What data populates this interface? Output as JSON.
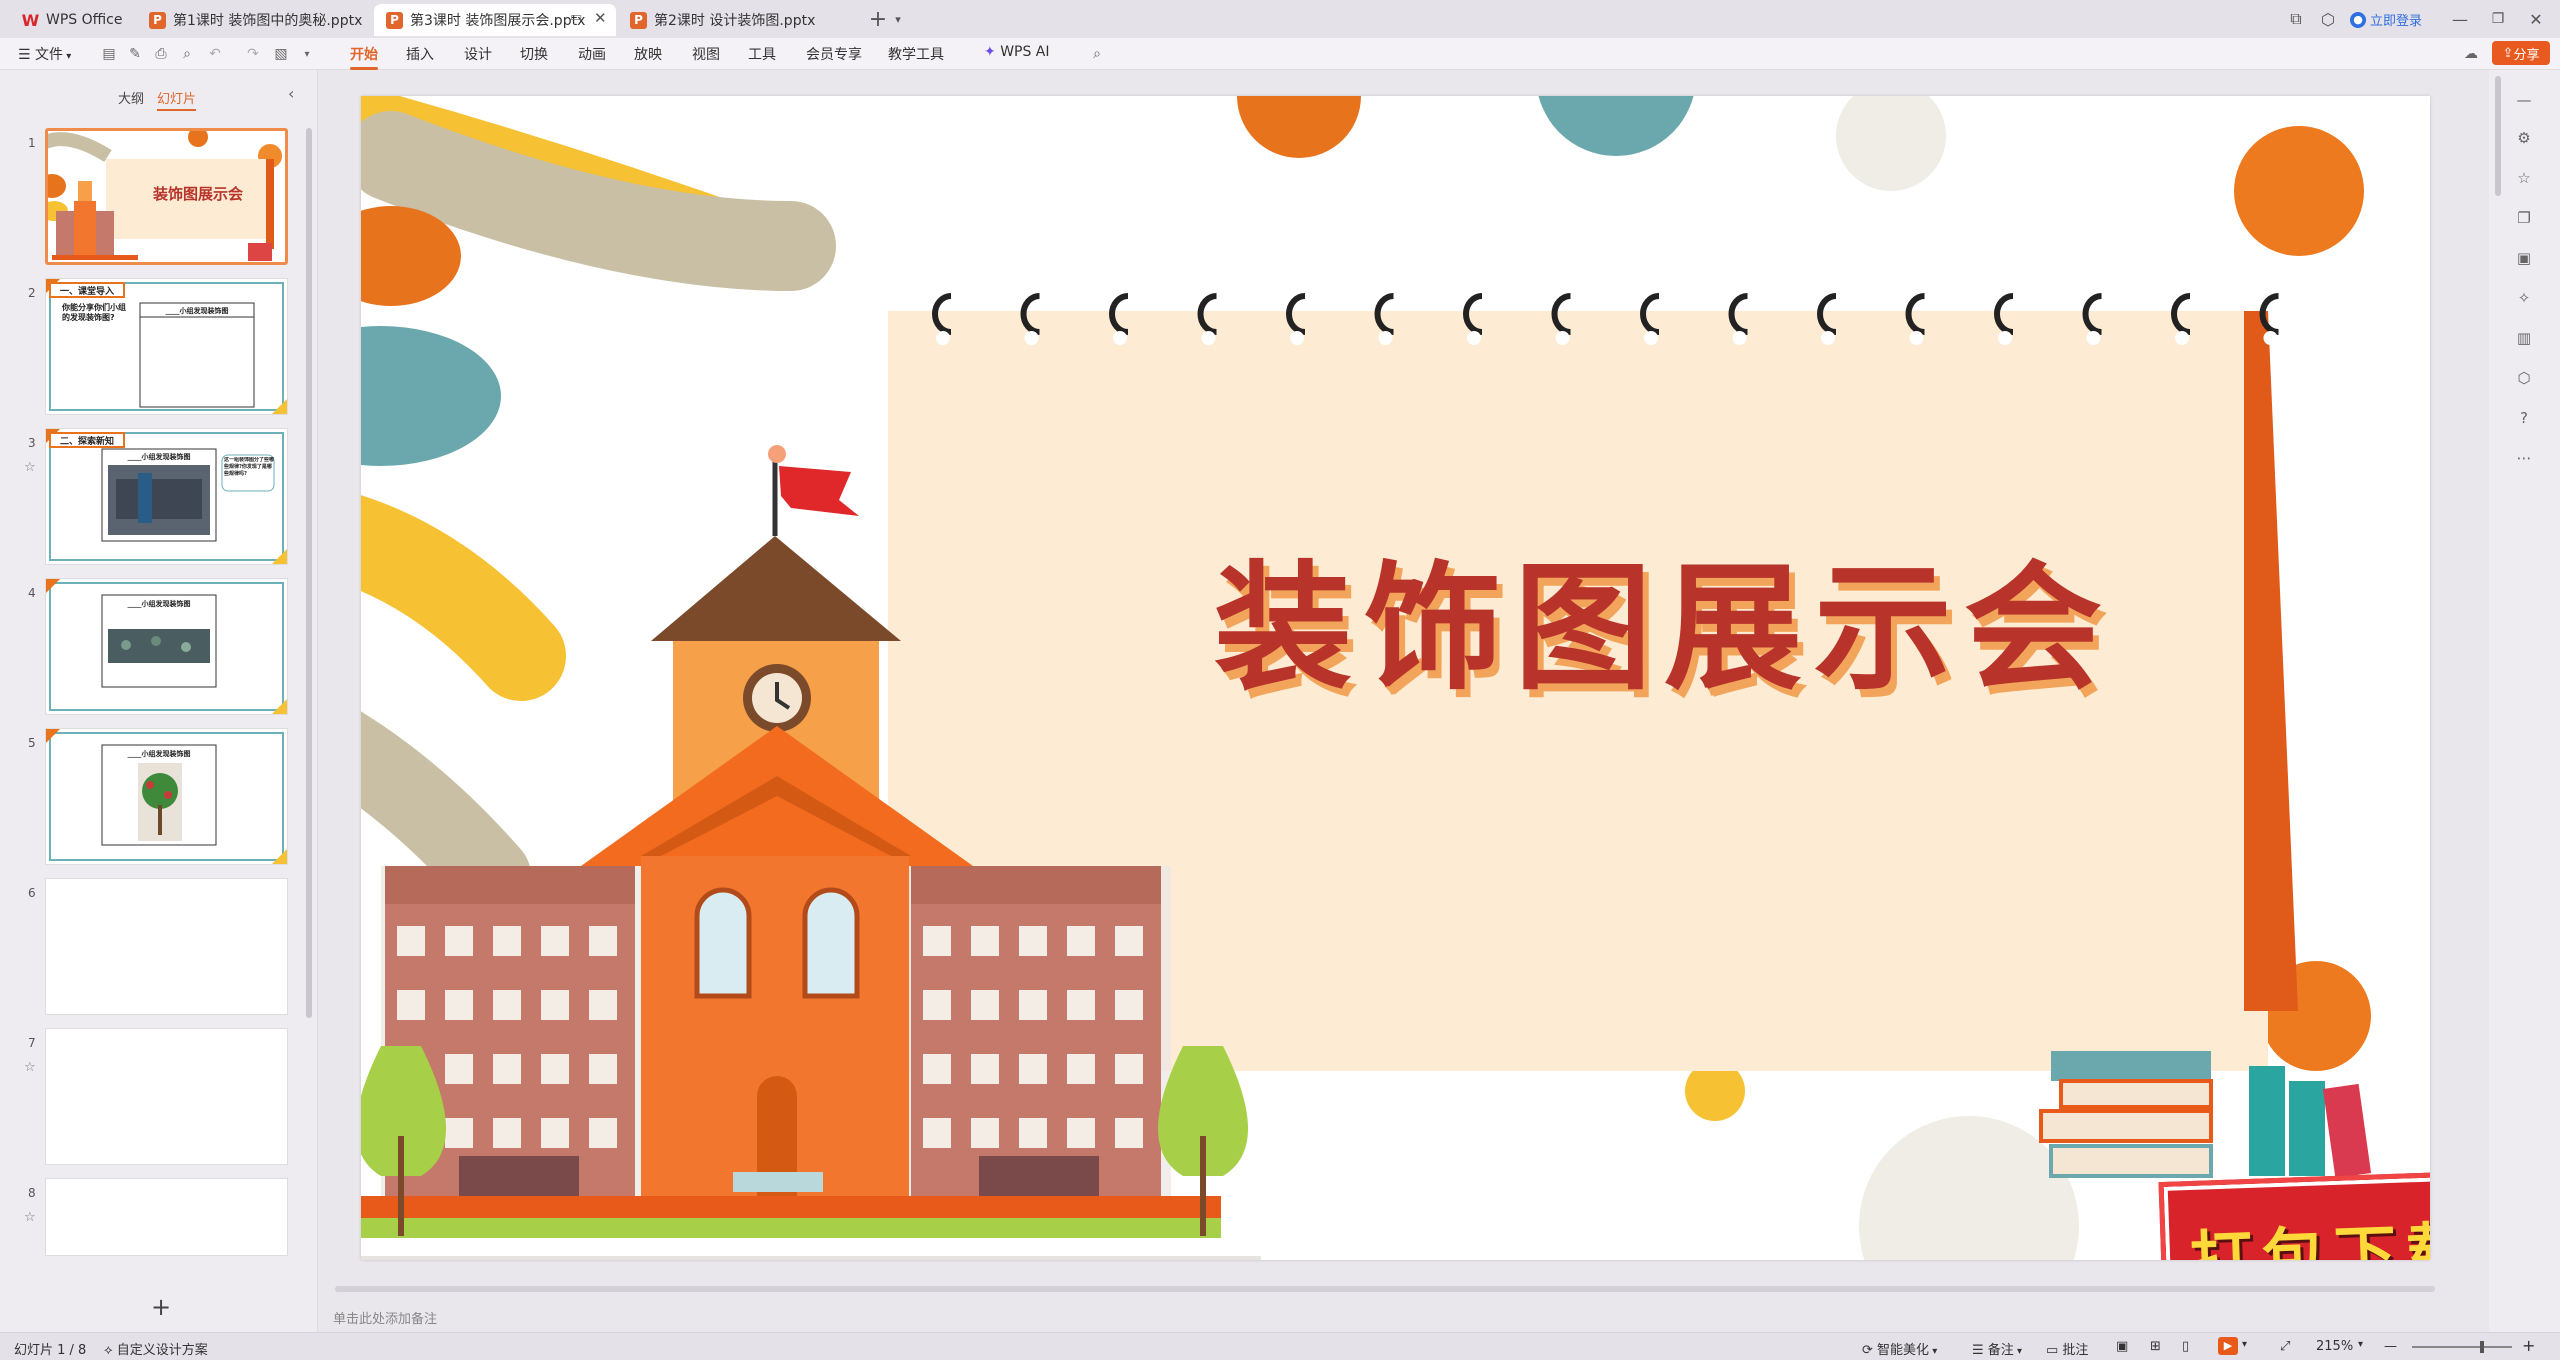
{
  "titlebar": {
    "tabs": [
      {
        "label": "WPS Office",
        "icon": "wps-logo-icon",
        "active": false
      },
      {
        "label": "第1课时 装饰图中的奥秘.pptx",
        "icon": "ppt-file-icon",
        "active": false
      },
      {
        "label": "第3课时 装饰图展示会.pptx",
        "icon": "ppt-file-icon",
        "active": true
      },
      {
        "label": "第2课时 设计装饰图.pptx",
        "icon": "ppt-file-icon",
        "active": false
      }
    ],
    "login_label": "立即登录"
  },
  "ribbon": {
    "file_label": "文件",
    "tabs": [
      "开始",
      "插入",
      "设计",
      "切换",
      "动画",
      "放映",
      "视图",
      "工具",
      "会员专享",
      "教学工具"
    ],
    "active_tab": "开始",
    "ai_label": "WPS AI",
    "share_label": "分享"
  },
  "left_panel": {
    "tabs": [
      "大纲",
      "幻灯片"
    ],
    "active_tab": "幻灯片",
    "slides": [
      {
        "number": "1",
        "title": "装饰图展示会",
        "starred": false
      },
      {
        "number": "2",
        "heading": "一、课堂导入",
        "text": "你能分享你们小组的发现装饰图?",
        "box_title": "____小组发现装饰图",
        "starred": false
      },
      {
        "number": "3",
        "heading": "二、探索新知",
        "box_title": "____小组发现装饰图",
        "note": "这一组装饰图分了些哪些规律?你发现了是哪些规律吗?",
        "starred": true
      },
      {
        "number": "4",
        "box_title": "____小组发现装饰图",
        "starred": false
      },
      {
        "number": "5",
        "box_title": "____小组发现装饰图",
        "starred": false
      },
      {
        "number": "6",
        "starred": false
      },
      {
        "number": "7",
        "starred": true
      },
      {
        "number": "8",
        "starred": true
      }
    ]
  },
  "slide": {
    "title": "装饰图展示会",
    "download_banner": "打包下载"
  },
  "notes_placeholder": "单击此处添加备注",
  "statusbar": {
    "slide_counter": "幻灯片 1 / 8",
    "design_scheme": "自定义设计方案",
    "smart_beautify": "智能美化",
    "notes": "备注",
    "comments": "批注",
    "zoom": "215%"
  },
  "colors": {
    "accent": "#e0662b",
    "title_text": "#b8342a",
    "notebook_paper": "#fdebd3",
    "banner_red": "#d8232a",
    "banner_text": "#ffd83a"
  }
}
